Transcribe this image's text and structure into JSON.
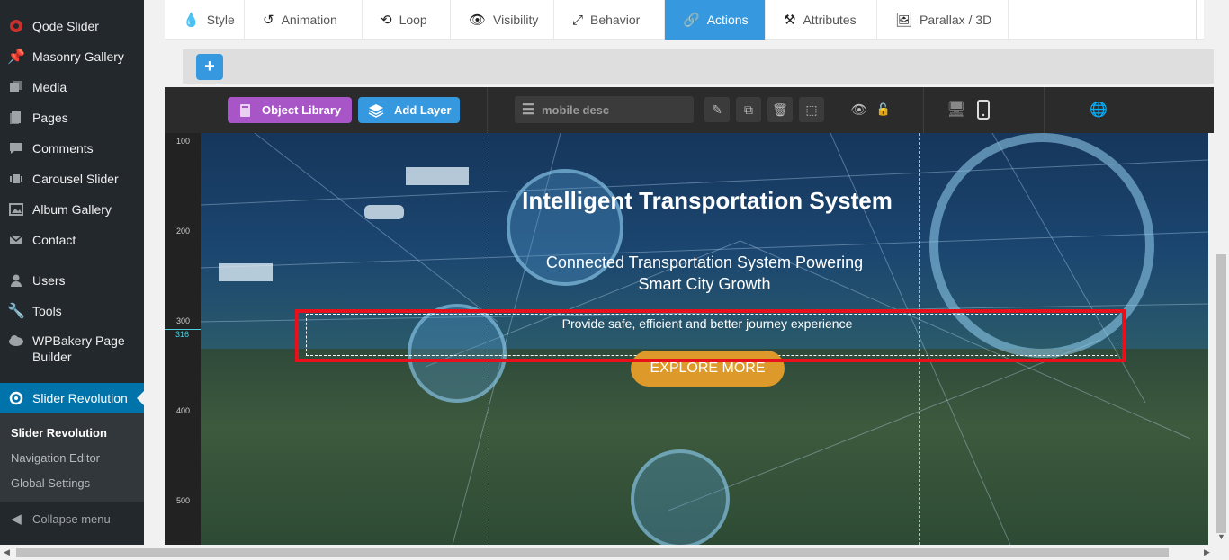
{
  "sidebar": {
    "items": [
      {
        "label": "Qode Slider",
        "icon": "qode-icon"
      },
      {
        "label": "Masonry Gallery",
        "icon": "pin-icon"
      },
      {
        "label": "Media",
        "icon": "media-icon"
      },
      {
        "label": "Pages",
        "icon": "pages-icon"
      },
      {
        "label": "Comments",
        "icon": "comments-icon"
      },
      {
        "label": "Carousel Slider",
        "icon": "carousel-icon"
      },
      {
        "label": "Album Gallery",
        "icon": "album-icon"
      },
      {
        "label": "Contact",
        "icon": "mail-icon"
      },
      {
        "label": "Users",
        "icon": "users-icon"
      },
      {
        "label": "Tools",
        "icon": "wrench-icon"
      },
      {
        "label": "WPBakery Page Builder",
        "icon": "cloud-icon"
      },
      {
        "label": "Slider Revolution",
        "icon": "refresh-icon"
      }
    ],
    "submenu": [
      "Slider Revolution",
      "Navigation Editor",
      "Global Settings"
    ],
    "collapse_label": "Collapse menu"
  },
  "tabs": [
    {
      "label": "Style",
      "icon": "drop-icon"
    },
    {
      "label": "Animation",
      "icon": "history-icon"
    },
    {
      "label": "Loop",
      "icon": "loop-icon"
    },
    {
      "label": "Visibility",
      "icon": "eye-icon"
    },
    {
      "label": "Behavior",
      "icon": "expand-icon"
    },
    {
      "label": "Actions",
      "icon": "link-icon"
    },
    {
      "label": "Attributes",
      "icon": "tools-icon"
    },
    {
      "label": "Parallax / 3D",
      "icon": "image-icon"
    }
  ],
  "active_tab": "Actions",
  "toolbar": {
    "object_library": "Object Library",
    "add_layer": "Add Layer",
    "layer_name": "mobile desc",
    "plus": "+"
  },
  "ruler": {
    "labels": [
      "100",
      "200",
      "300",
      "400",
      "500"
    ],
    "marker": "316"
  },
  "slide": {
    "title": "Intelligent Transportation System",
    "subtitle_line1": "Connected Transportation System Powering",
    "subtitle_line2": "Smart City Growth",
    "description": "Provide safe, efficient and better journey experience",
    "button": "EXPLORE MORE"
  },
  "colors": {
    "wp_sidebar": "#23282d",
    "wp_active": "#0073aa",
    "tab_active": "#3699e0",
    "object_library": "#a855c8",
    "explore_button": "#dd9a2a",
    "selection_frame": "#e8101a"
  }
}
